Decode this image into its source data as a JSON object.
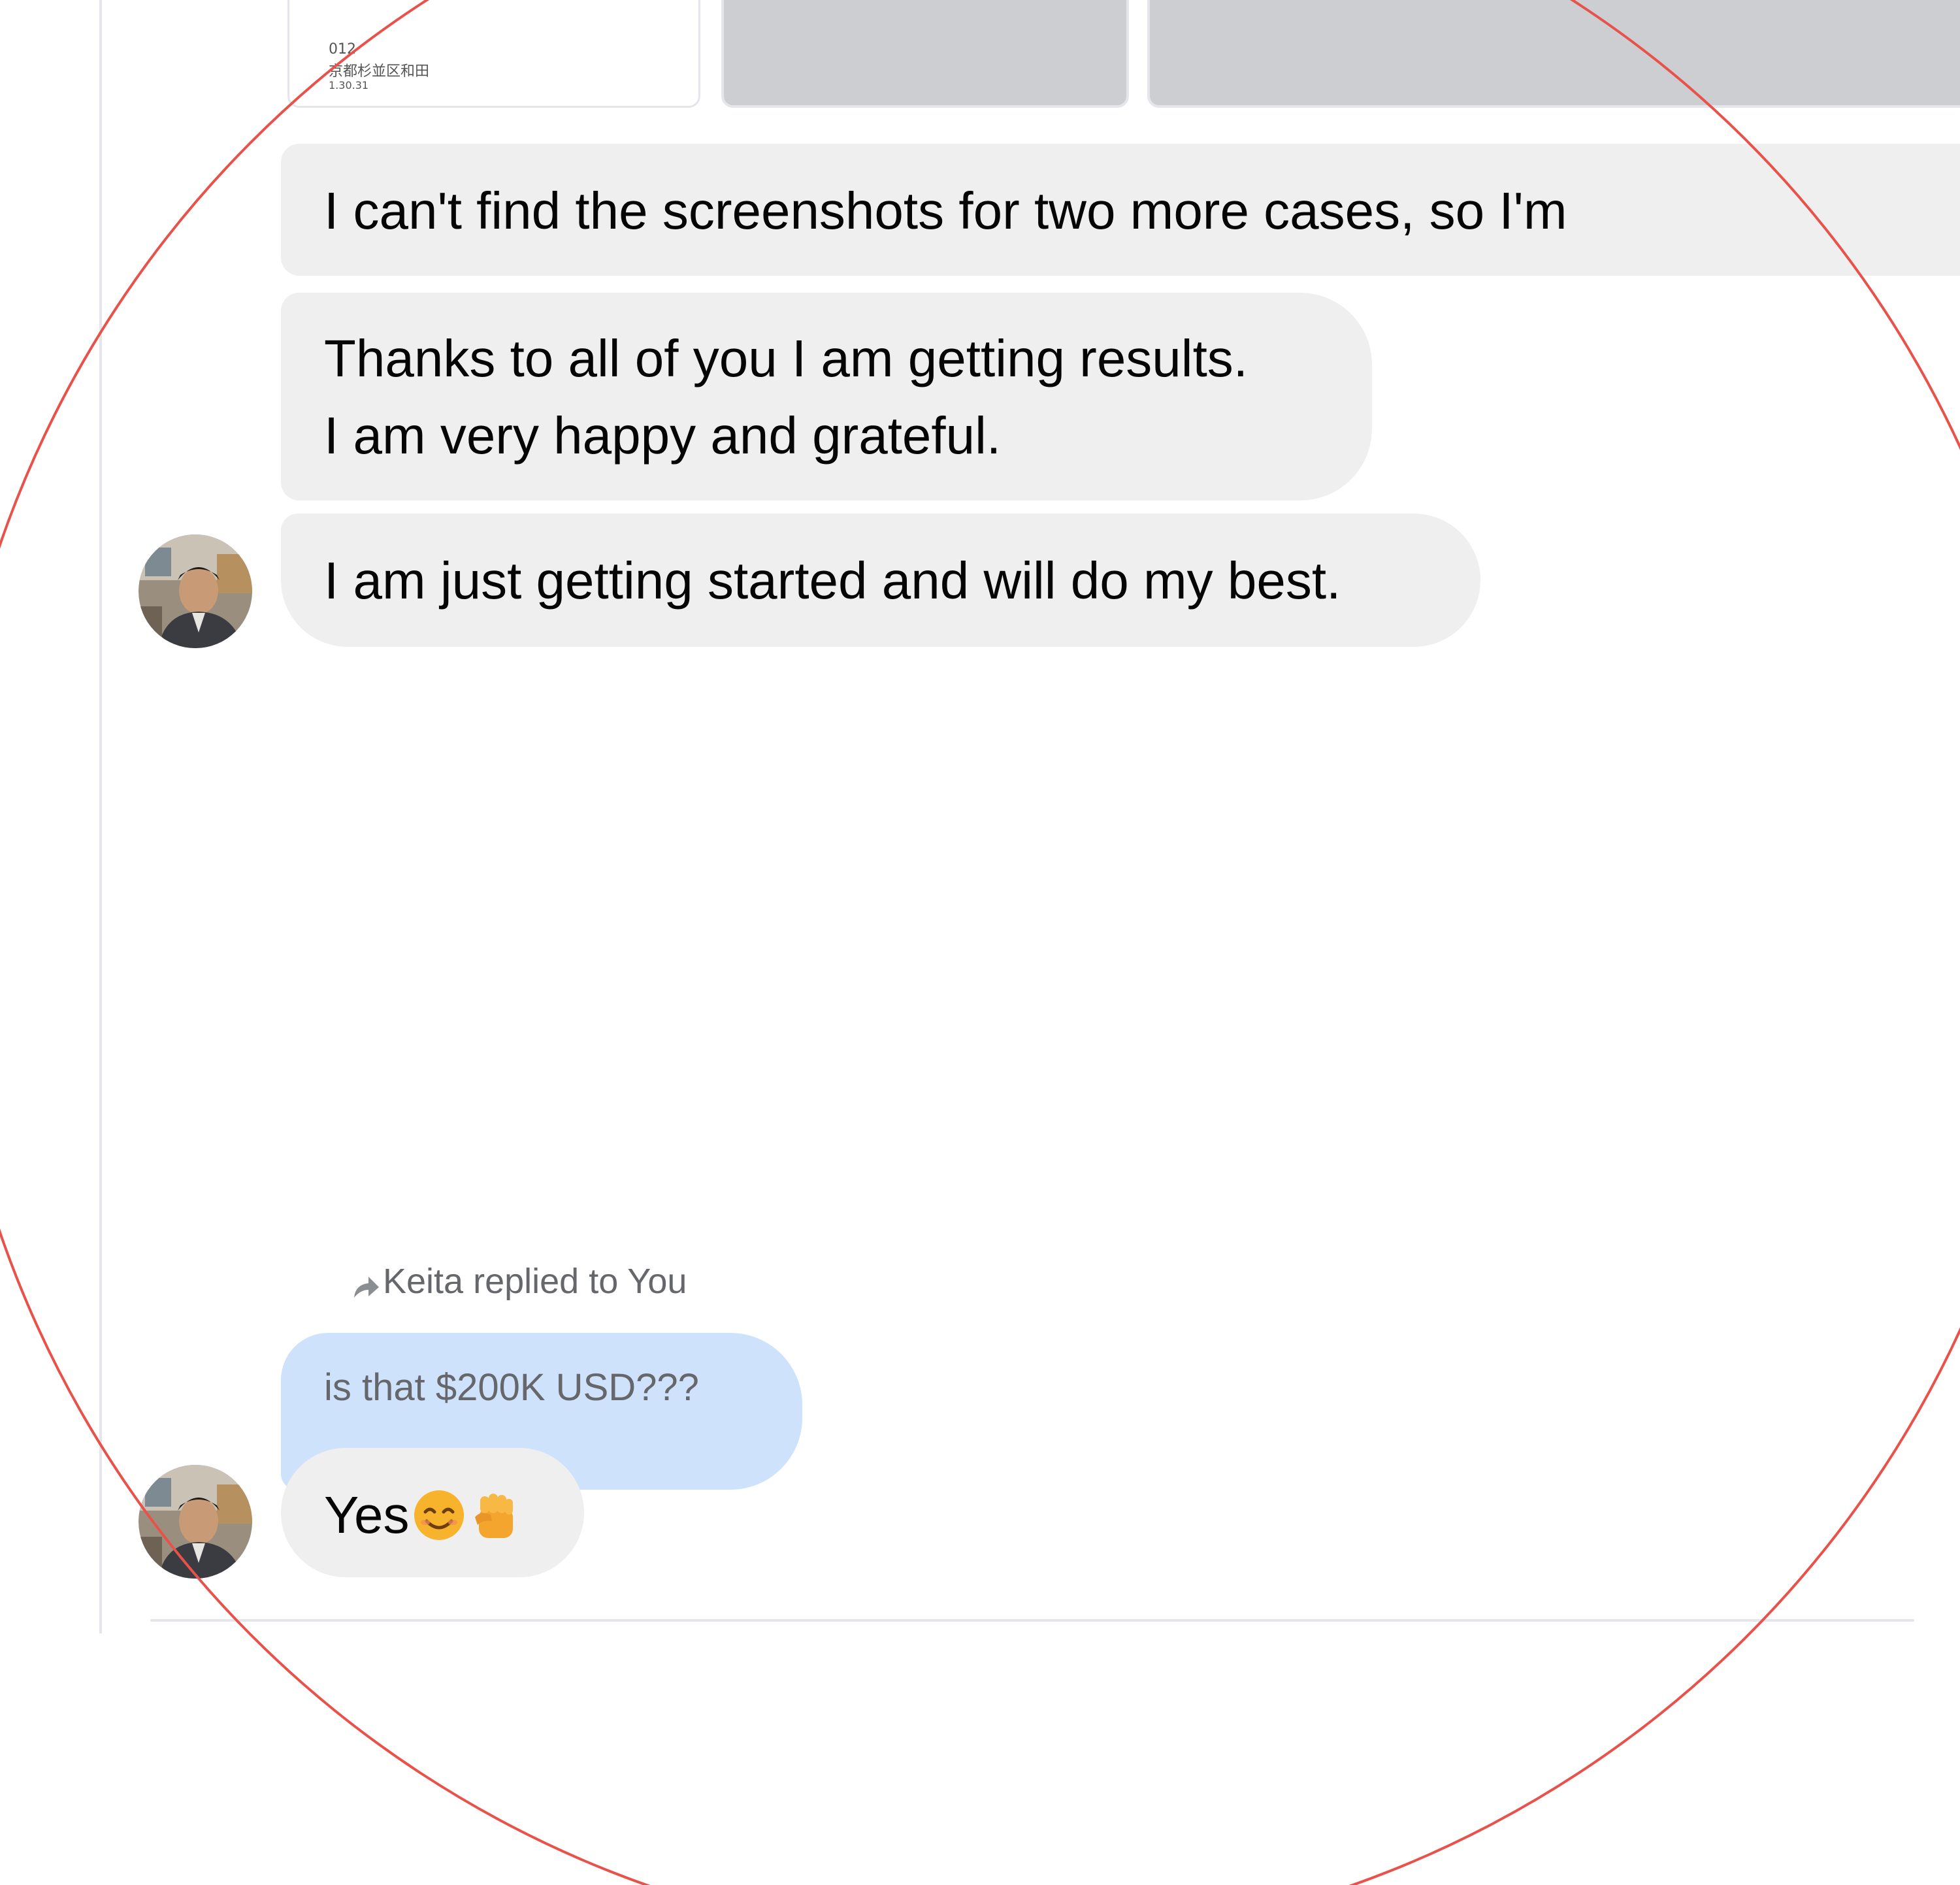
{
  "attachments": {
    "doc_preview": {
      "lines": [
        "012",
        "京都杉並区和田",
        "1.30.31"
      ]
    }
  },
  "messages": [
    {
      "text": "I can't find the screenshots for two more cases, so I'm"
    },
    {
      "lines": [
        "Thanks to all of you I am getting results.",
        "I am very happy and grateful."
      ]
    },
    {
      "text": "I am just getting started and will do my best."
    }
  ],
  "reply": {
    "label": "Keita replied to You",
    "quoted_text": "is that $200K USD???",
    "text": "Yes",
    "emojis": [
      "smiling-face-emoji",
      "raised-fist-emoji"
    ]
  },
  "icons": {
    "reply": "reply-arrow-icon",
    "avatar": "user-avatar"
  },
  "colors": {
    "bubble_gray": "#efefef",
    "quoted_blue": "#cfe2fc",
    "highlight_circle": "#e8524a"
  }
}
